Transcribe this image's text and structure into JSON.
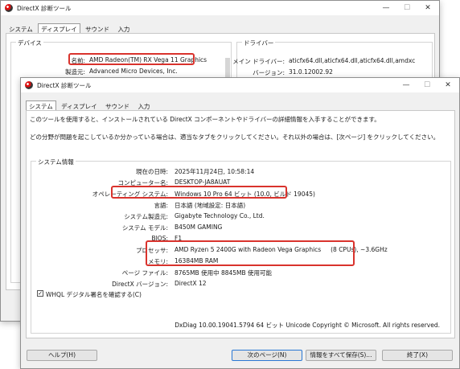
{
  "back_window": {
    "title": "DirectX 診断ツール",
    "tabs": [
      "システム",
      "ディスプレイ",
      "サウンド",
      "入力"
    ],
    "device_group_label": "デバイス",
    "driver_group_label": "ドライバー",
    "name_label": "名前:",
    "name_value": "AMD Radeon(TM) RX Vega 11 Graphics",
    "maker_label": "製造元:",
    "maker_value": "Advanced Micro Devices, Inc.",
    "main_driver_label": "メイン ドライバー:",
    "main_driver_value": "aticfx64.dll,aticfx64.dll,aticfx64.dll,amdxc",
    "version_label": "バージョン:",
    "version_value": "31.0.12002.92"
  },
  "front_window": {
    "title": "DirectX 診断ツール",
    "tabs": [
      "システム",
      "ディスプレイ",
      "サウンド",
      "入力"
    ],
    "intro1": "このツールを使用すると、インストールされている DirectX コンポーネントやドライバーの詳細情報を入手することができます。",
    "intro2": "どの分野が問題を起こしているか分かっている場合は、適当なタブをクリックしてください。それ以外の場合は、[次ページ] をクリックしてください。",
    "sysinfo_label": "システム情報",
    "rows": [
      {
        "label": "現在の日時:",
        "value": "2025年11月24日, 10:58:14"
      },
      {
        "label": "コンピューター名:",
        "value": "DESKTOP-JA8AUAT"
      },
      {
        "label": "オペレーティング システム:",
        "value": "Windows 10 Pro 64 ビット (10.0, ビルド 19045)"
      },
      {
        "label": "言語:",
        "value": "日本語 (地域設定: 日本語)"
      },
      {
        "label": "システム製造元:",
        "value": "Gigabyte Technology Co., Ltd."
      },
      {
        "label": "システム モデル:",
        "value": "B450M GAMING"
      },
      {
        "label": "BIOS:",
        "value": "F1"
      },
      {
        "label": "プロセッサ:",
        "value": "AMD Ryzen 5 2400G with Radeon Vega Graphics     (8 CPUs), ~3.6GHz"
      },
      {
        "label": "メモリ:",
        "value": "16384MB RAM"
      },
      {
        "label": "ページ ファイル:",
        "value": "8765MB 使用中 8845MB 使用可能"
      },
      {
        "label": "DirectX バージョン:",
        "value": "DirectX 12"
      }
    ],
    "whql_label": "WHQL デジタル署名を確認する(C)",
    "dxdiag_info": "DxDiag 10.00.19041.5794 64 ビット Unicode  Copyright © Microsoft. All rights reserved.",
    "buttons": {
      "help": "ヘルプ(H)",
      "next": "次のページ(N)",
      "save_all": "情報をすべて保存(S)...",
      "exit": "終了(X)"
    }
  },
  "colors": {
    "highlight": "#d9332d"
  }
}
